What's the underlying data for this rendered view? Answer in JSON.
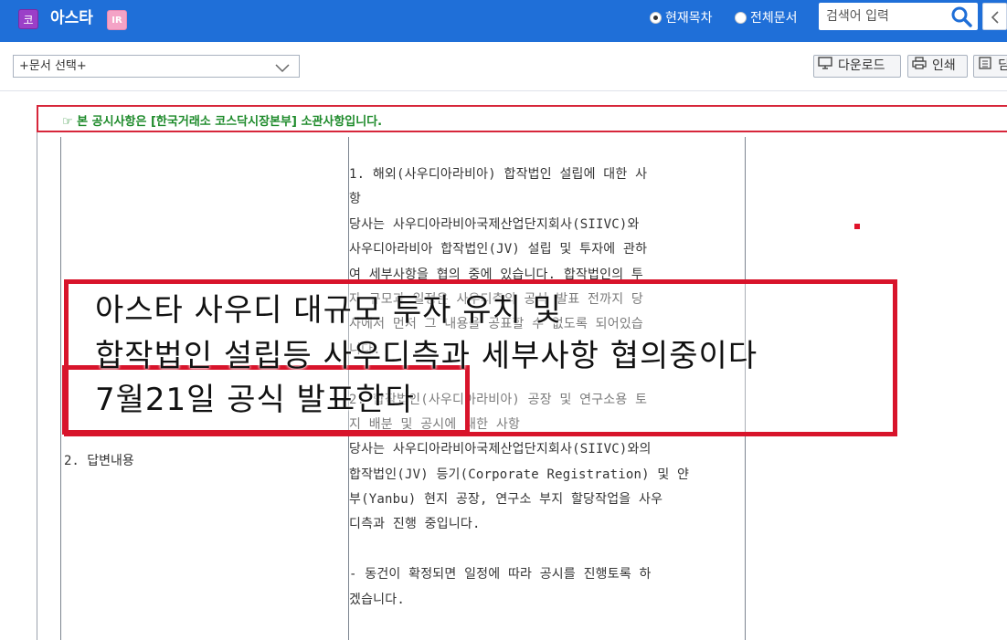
{
  "header": {
    "ko_badge": "코",
    "company_name": "아스타",
    "ir_badge": "IR",
    "radio_current": "현재목차",
    "radio_all": "전체문서",
    "search_placeholder": "검색어 입력"
  },
  "toolbar": {
    "doc_select_value": "+문서 선택+",
    "download_label": "다운로드",
    "print_label": "인쇄",
    "extra_label": "딤"
  },
  "notice": {
    "text": "☞ 본 공시사항은 [한국거래소 코스닥시장본부] 소관사항입니다."
  },
  "table": {
    "answer_label": "2. 답변내용",
    "content_lines": [
      "1. 해외(사우디아라비아) 합작법인 설립에 대한 사",
      "항",
      "당사는 사우디아라비아국제산업단지회사(SIIVC)와",
      "사우디아라비아 합작법인(JV) 설립 및 투자에 관하",
      "여 세부사항을 협의 중에 있습니다. 합작법인의 투",
      "자 규모과 일정은 사우디측의 공식 발표 전까지 당",
      "사에서 먼저 그 내용을 공표할 수 없도록 되어있습",
      "니다.",
      "",
      "2. 합작법인(사우디아라비아) 공장 및 연구소용 토",
      "지 배분 및 공시에 대한 사항",
      "당사는 사우디아라비아국제산업단지회사(SIIVC)와의",
      "합작법인(JV) 등기(Corporate Registration) 및 얀",
      "부(Yanbu) 현지 공장, 연구소 부지 할당작업을 사우",
      "디측과 진행 중입니다.",
      "",
      "- 동건이 확정되면 일정에 따라 공시를 진행토록 하",
      "겠습니다."
    ]
  },
  "overlay": {
    "line1": "아스타 사우디 대규모 투자 유치 및",
    "line2": "합작법인 설립등 사우디측과 세부사항 협의중이다",
    "line3": "7월21일 공식 발표한다"
  },
  "colors": {
    "header_blue": "#1f6fd8",
    "notice_red": "#d7263a",
    "notice_green": "#1d8a2a",
    "overlay_red": "#d8142b"
  }
}
